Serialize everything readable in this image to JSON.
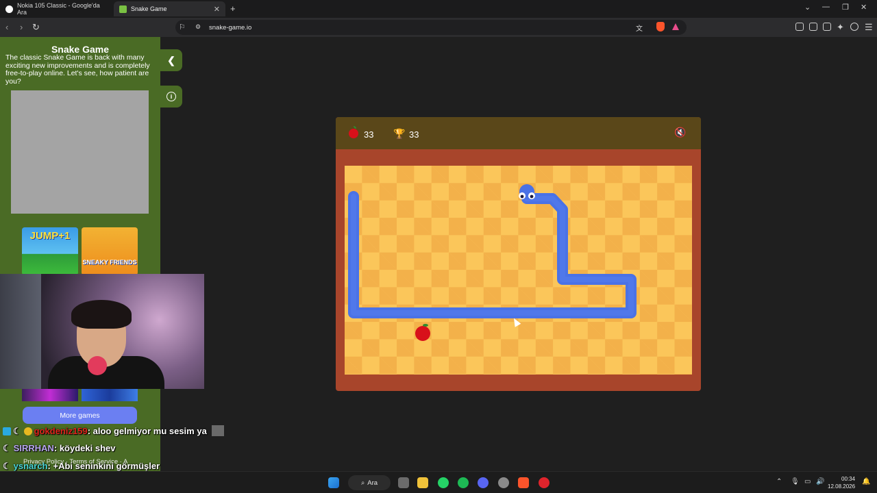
{
  "browser": {
    "tabs": [
      {
        "title": "Nokia 105 Classic - Google'da Ara"
      },
      {
        "title": "Snake Game"
      }
    ],
    "url": "snake-game.io"
  },
  "sidebar": {
    "title": "Snake Game",
    "description": "The classic Snake Game is back with many exciting new improvements and is completely free-to-play online. Let's see, how patient are you?",
    "more_games_label": "More games",
    "thumb1_text": "JUMP+1",
    "thumb2_text": "SNEAKY FRIENDS",
    "footer_links": "Privacy Policy · Terms of Service · A"
  },
  "game": {
    "score": "33",
    "best": "33",
    "colors": {
      "snake": "#4a72e6",
      "apple": "#d8101a",
      "board_light": "#fbc65a",
      "board_dark": "#f3b14a"
    }
  },
  "chat": [
    {
      "user": "gokdeniz159",
      "message": ": aloo gelmiyor mu sesim ya"
    },
    {
      "user": "SIRRHAN",
      "message": ": köydeki shev"
    },
    {
      "user": "ysnarch",
      "message": ": +Abi seninkini görmüşler"
    }
  ],
  "taskbar": {
    "search_label": "Ara",
    "time": "00:34",
    "date": "12.08.2026"
  }
}
